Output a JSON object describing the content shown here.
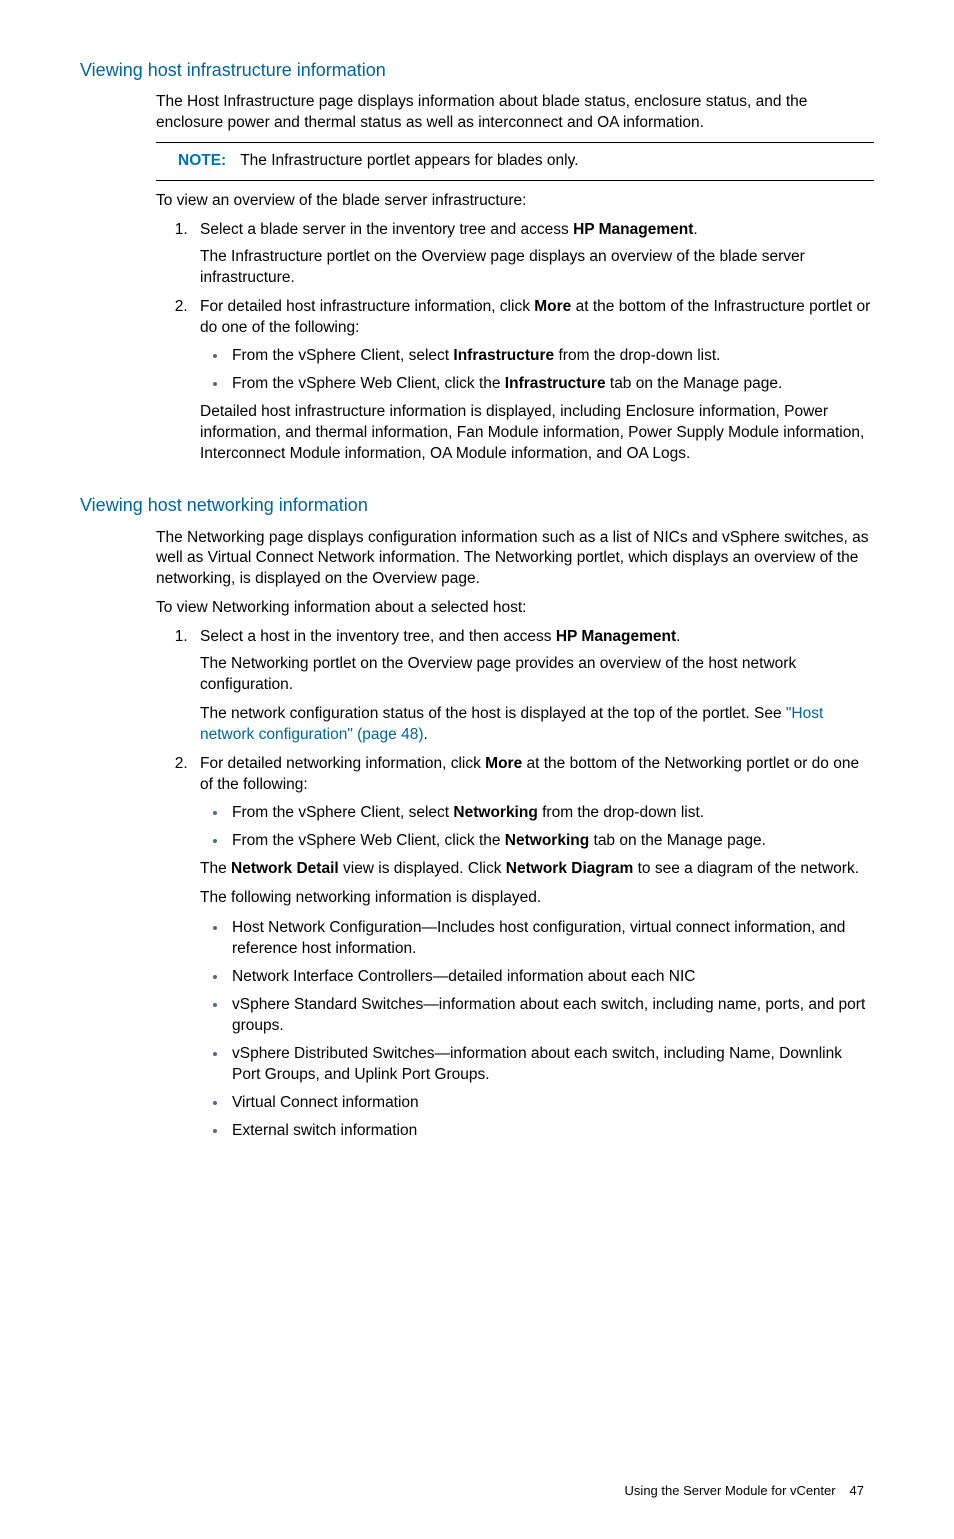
{
  "section1": {
    "heading": "Viewing host infrastructure information",
    "intro": "The Host Infrastructure page displays information about blade status, enclosure status, and the enclosure power and thermal status as well as interconnect and OA information.",
    "note_label": "NOTE:",
    "note_text": "The Infrastructure portlet appears for blades only.",
    "lead": "To view an overview of the blade server infrastructure:",
    "step1_a": "Select a blade server in the inventory tree and access ",
    "step1_b_bold": "HP Management",
    "step1_c": ".",
    "step1_p2": "The Infrastructure portlet on the Overview page displays an overview of the blade server infrastructure.",
    "step2_a": "For detailed host infrastructure information, click ",
    "step2_b_bold": "More",
    "step2_c": " at the bottom of the Infrastructure portlet or do one of the following:",
    "step2_b1_a": "From the vSphere Client, select ",
    "step2_b1_bold": "Infrastructure",
    "step2_b1_c": " from the drop-down list.",
    "step2_b2_a": "From the vSphere Web Client, click the ",
    "step2_b2_bold": "Infrastructure",
    "step2_b2_c": " tab on the Manage page.",
    "step2_p3": "Detailed host infrastructure information is displayed, including Enclosure information, Power information, and thermal information, Fan Module information, Power Supply Module information, Interconnect Module information, OA Module information, and OA Logs."
  },
  "section2": {
    "heading": "Viewing host networking information",
    "intro": "The Networking page displays configuration information such as a list of NICs and vSphere switches, as well as Virtual Connect Network information. The Networking portlet, which displays an overview of the networking, is displayed on the Overview page.",
    "lead": "To view Networking information about a selected host:",
    "step1_a": "Select a host in the inventory tree, and then access ",
    "step1_bold": "HP Management",
    "step1_c": ".",
    "step1_p2": "The Networking portlet on the Overview page provides an overview of the host network configuration.",
    "step1_p3a": "The network configuration status of the host is displayed at the top of the portlet. See ",
    "step1_link": "\"Host network configuration\" (page 48)",
    "step1_p3c": ".",
    "step2_a": "For detailed networking information, click ",
    "step2_bold": "More",
    "step2_c": " at the bottom of the Networking portlet or do one of the following:",
    "step2_b1_a": "From the vSphere Client, select ",
    "step2_b1_bold": "Networking",
    "step2_b1_c": " from the drop-down list.",
    "step2_b2_a": "From the vSphere Web Client, click the ",
    "step2_b2_bold": "Networking",
    "step2_b2_c": " tab on the Manage page.",
    "step2_p3a": "The ",
    "step2_p3b_bold": "Network Detail",
    "step2_p3c": " view is displayed. Click ",
    "step2_p3d_bold": "Network Diagram",
    "step2_p3e": " to see a diagram of the network.",
    "step2_p4": "The following networking information is displayed.",
    "info_list": [
      "Host Network Configuration—Includes host configuration, virtual connect information, and reference host information.",
      "Network Interface Controllers—detailed information about each NIC",
      "vSphere Standard Switches—information about each switch, including name, ports, and port groups.",
      "vSphere Distributed Switches—information about each switch, including Name, Downlink Port Groups, and Uplink Port Groups.",
      "Virtual Connect information",
      "External switch information"
    ]
  },
  "footer": {
    "text": "Using the Server Module for vCenter",
    "page": "47"
  }
}
